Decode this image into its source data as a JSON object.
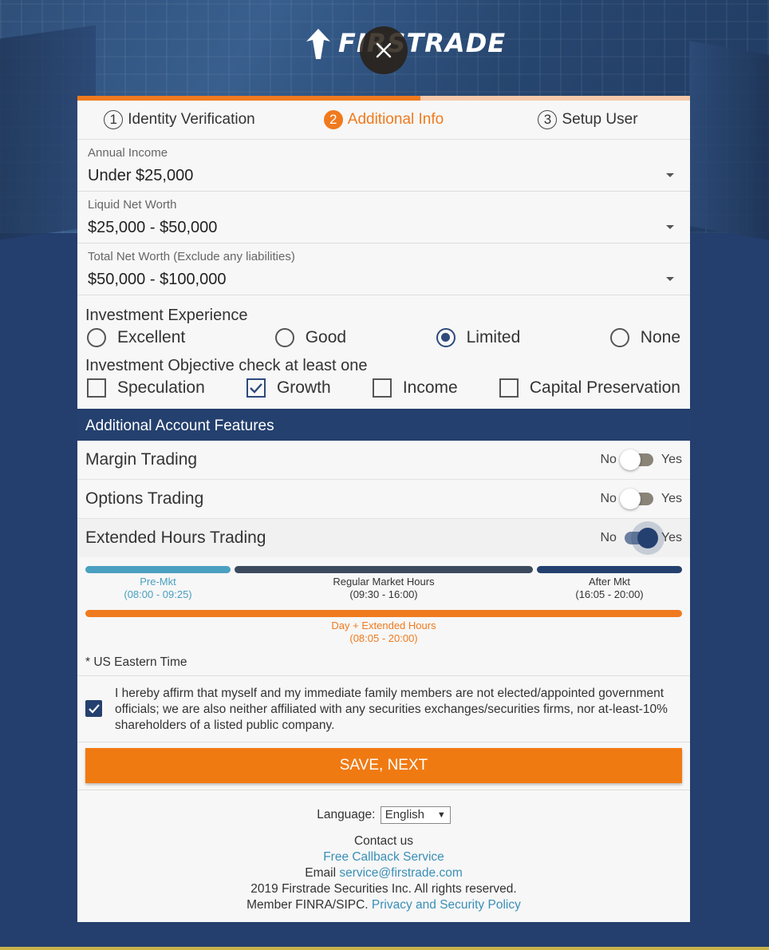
{
  "brand": {
    "logo_text": "FIRSTRADE"
  },
  "steps": [
    {
      "num": "1",
      "label": "Identity Verification"
    },
    {
      "num": "2",
      "label": "Additional Info"
    },
    {
      "num": "3",
      "label": "Setup User"
    }
  ],
  "progress": {
    "fraction": 0.56
  },
  "fields": {
    "annual_income": {
      "label": "Annual Income",
      "value": "Under $25,000"
    },
    "liquid_net_worth": {
      "label": "Liquid Net Worth",
      "value": "$25,000 - $50,000"
    },
    "total_net_worth": {
      "label": "Total Net Worth (Exclude any liabilities)",
      "value": "$50,000 - $100,000"
    }
  },
  "experience": {
    "title": "Investment Experience",
    "options": [
      "Excellent",
      "Good",
      "Limited",
      "None"
    ],
    "selected": "Limited"
  },
  "objective": {
    "title": "Investment Objective check at least one",
    "options": [
      "Speculation",
      "Growth",
      "Income",
      "Capital Preservation"
    ],
    "checked": [
      "Growth"
    ]
  },
  "features": {
    "title": "Additional Account Features",
    "no_label": "No",
    "yes_label": "Yes",
    "items": [
      {
        "label": "Margin Trading",
        "on": false
      },
      {
        "label": "Options Trading",
        "on": false
      },
      {
        "label": "Extended Hours Trading",
        "on": true
      }
    ]
  },
  "hours": {
    "pre": {
      "name": "Pre-Mkt",
      "time": "(08:00 - 09:25)"
    },
    "regular": {
      "name": "Regular Market Hours",
      "time": "(09:30 - 16:00)"
    },
    "after": {
      "name": "After Mkt",
      "time": "(16:05 - 20:00)"
    },
    "extended": {
      "name": "Day + Extended Hours",
      "time": "(08:05 - 20:00)"
    },
    "note": "* US Eastern Time"
  },
  "affirm": {
    "checked": true,
    "text": "I hereby affirm that myself and my immediate family members are not elected/appointed government officials; we are also neither affiliated with any securities exchanges/securities firms, nor at-least-10% shareholders of a listed public company."
  },
  "save_label": "SAVE, NEXT",
  "footer": {
    "language_label": "Language:",
    "language_value": "English",
    "contact": "Contact us",
    "callback": "Free Callback Service",
    "email_label": "Email",
    "email": "service@firstrade.com",
    "copyright": "2019 Firstrade Securities Inc. All rights reserved.",
    "member": "Member FINRA/SIPC.",
    "privacy": "Privacy and Security Policy"
  },
  "colors": {
    "accent": "#f07a1e",
    "navy": "#24406e",
    "link": "#3a8fb7",
    "pre_bar": "#4aa0c0",
    "regular_bar": "#3c4a5e"
  }
}
